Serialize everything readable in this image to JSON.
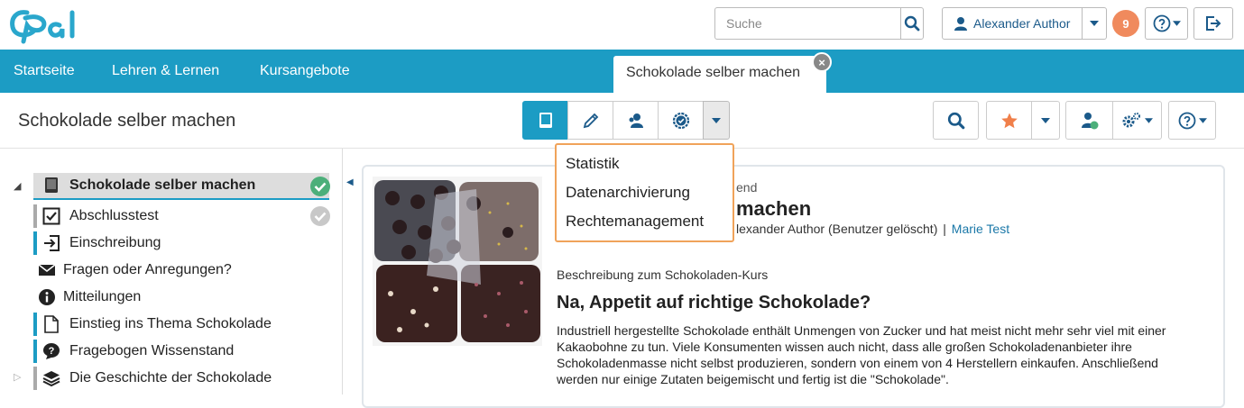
{
  "header": {
    "logo_text": "Opal",
    "search_placeholder": "Suche",
    "user_name": "Alexander Author",
    "notification_count": "9"
  },
  "nav": {
    "items": [
      "Startseite",
      "Lehren & Lernen",
      "Kursangebote"
    ],
    "active_tab": "Schokolade selber machen",
    "close_symbol": "×"
  },
  "course": {
    "title": "Schokolade selber machen"
  },
  "dropdown": {
    "items": [
      "Statistik",
      "Datenarchivierung",
      "Rechtemanagement"
    ]
  },
  "tree": {
    "root": "Schokolade selber machen",
    "items": [
      "Abschlusstest",
      "Einschreibung",
      "Fragen oder Anregungen?",
      "Mitteilungen",
      "Einstieg ins Thema Schokolade",
      "Fragebogen Wissenstand",
      "Die Geschichte der Schokolade"
    ]
  },
  "main": {
    "meta_top": "end",
    "title_visible": "machen",
    "authors_visible": "lexander Author (Benutzer gelöscht)",
    "authors_separator": "|",
    "author_link": "Marie Test",
    "description_label": "Beschreibung zum Schokoladen-Kurs",
    "heading": "Na, Appetit auf richtige Schokolade?",
    "paragraph": "Industriell hergestellte Schokolade enthält Unmengen von Zucker und hat meist nicht mehr sehr viel mit einer Kakaobohne zu tun. Viele Konsumenten wissen auch nicht, dass alle großen Schokoladenanbieter ihre Schokoladenmasse nicht selbst produzieren, sondern von einem von 4 Herstellern einkaufen. Anschließend werden nur einige Zutaten beigemischt und fertig ist die \"Schokolade\"."
  },
  "colors": {
    "brand": "#1c9cc4",
    "badge": "#f08a5d",
    "dropdown_border": "#f0a35a",
    "check_green": "#4caf7a",
    "star_orange": "#f07f4a"
  }
}
